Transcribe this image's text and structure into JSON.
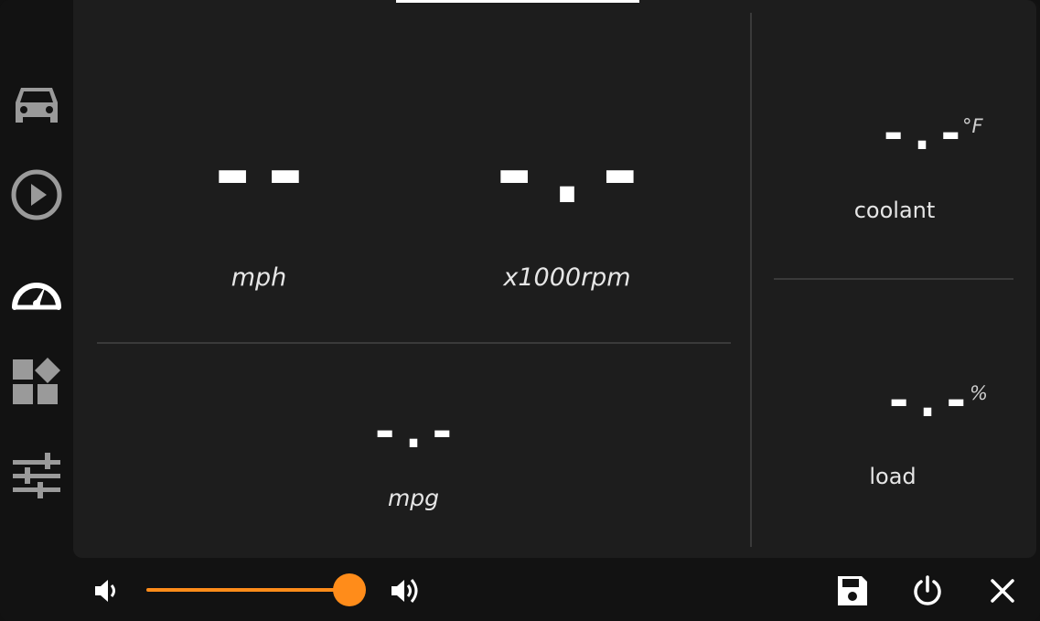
{
  "sidebar": {
    "items": [
      {
        "name": "car",
        "icon": "car-icon"
      },
      {
        "name": "media",
        "icon": "play-circle-icon"
      },
      {
        "name": "dashboard",
        "icon": "speedometer-icon",
        "active": true
      },
      {
        "name": "apps",
        "icon": "widgets-icon"
      },
      {
        "name": "settings",
        "icon": "sliders-icon"
      }
    ]
  },
  "gauges": {
    "speed": {
      "value": "--",
      "label": "mph"
    },
    "rpm": {
      "value": "-.-",
      "label": "x1000rpm"
    },
    "mpg": {
      "value": "-.-",
      "label": "mpg"
    },
    "coolant": {
      "value": "-.-",
      "unit": "°F",
      "label": "coolant"
    },
    "load": {
      "value": "-.-",
      "unit": "%",
      "label": "load"
    }
  },
  "bottom_bar": {
    "volume_level": 1.0,
    "volume_down_icon": "volume-down-icon",
    "volume_up_icon": "volume-up-icon",
    "save_icon": "save-icon",
    "power_icon": "power-icon",
    "close_icon": "close-icon"
  },
  "colors": {
    "accent": "#ff8c1a",
    "panel_bg": "#1d1d1d",
    "frame_bg": "#121212",
    "icon_inactive": "#9a9a9a",
    "icon_active": "#ffffff"
  }
}
